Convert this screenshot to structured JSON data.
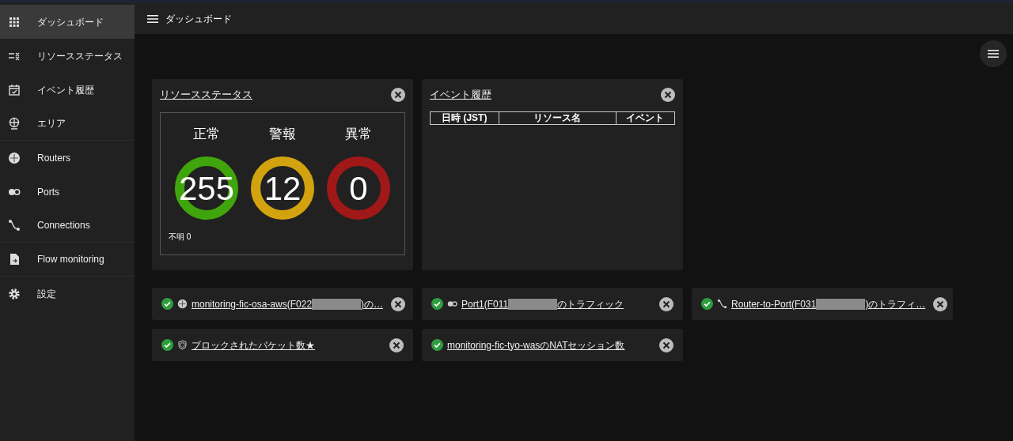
{
  "sidebar": {
    "items": [
      {
        "label": "ダッシュボード",
        "kind": "grid",
        "selected": true,
        "divider": false
      },
      {
        "label": "リソースステータス",
        "kind": "status",
        "selected": false,
        "divider": false
      },
      {
        "label": "イベント履歴",
        "kind": "calendar",
        "selected": false,
        "divider": false
      },
      {
        "label": "エリア",
        "kind": "globe",
        "selected": false,
        "divider": true
      },
      {
        "label": "Routers",
        "kind": "router",
        "selected": false,
        "divider": false
      },
      {
        "label": "Ports",
        "kind": "port",
        "selected": false,
        "divider": false
      },
      {
        "label": "Connections",
        "kind": "connection",
        "selected": false,
        "divider": true
      },
      {
        "label": "Flow monitoring",
        "kind": "file",
        "selected": false,
        "divider": true
      },
      {
        "label": "設定",
        "kind": "gear",
        "selected": false,
        "divider": false
      }
    ]
  },
  "header": {
    "title": "ダッシュボード"
  },
  "resource_status": {
    "title": "リソースステータス",
    "gauges": [
      {
        "label": "正常",
        "value": "255",
        "color": "#40a50d"
      },
      {
        "label": "警報",
        "value": "12",
        "color": "#d2a30e"
      },
      {
        "label": "異常",
        "value": "0",
        "color": "#a01818"
      }
    ],
    "unknown": "不明 0"
  },
  "event_history": {
    "title": "イベント履歴",
    "columns": [
      "日時 (JST)",
      "リソース名",
      "イベント"
    ]
  },
  "widgets": [
    {
      "kind": "router",
      "text_before": "monitoring-fic-osa-aws(F022",
      "redacted": true,
      "text_after": ")の…"
    },
    {
      "kind": "port",
      "text_before": "Port1(F011",
      "redacted": true,
      "text_after": "のトラフィック"
    },
    {
      "kind": "connection",
      "text_before": "Router-to-Port(F031",
      "redacted": true,
      "text_after": ")のトラフィ…"
    },
    {
      "kind": "shield",
      "text_before": "ブロックされたパケット数★",
      "redacted": false
    },
    {
      "kind": "plain",
      "text_before": "monitoring-fic-tyo-wasのNATセッション数",
      "redacted": false
    }
  ]
}
